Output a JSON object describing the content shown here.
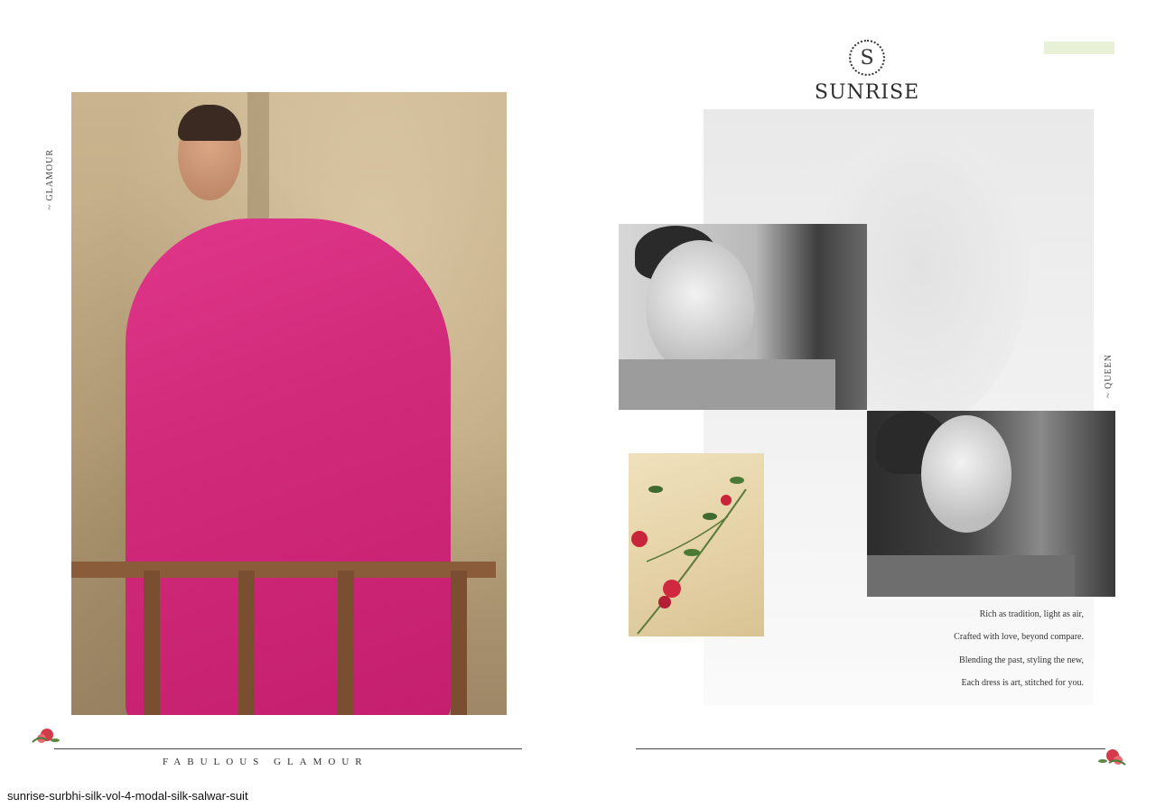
{
  "left_page": {
    "side_label": "~ GLAMOUR",
    "footer_text": "FABULOUS GLAMOUR"
  },
  "right_page": {
    "brand_initial": "S",
    "brand_name": "SUNRISE",
    "side_label": "~ QUEEN",
    "poem": [
      "Rich as tradition, light as air,",
      "Crafted with love, beyond compare.",
      "Blending the past, styling the new,",
      "Each dress is art, stitched for you."
    ]
  },
  "caption": "sunrise-surbhi-silk-vol-4-modal-silk-salwar-suit",
  "colors": {
    "dress": "#d12a7a",
    "accent_bar": "#e8f1d6",
    "rule": "#444444"
  }
}
